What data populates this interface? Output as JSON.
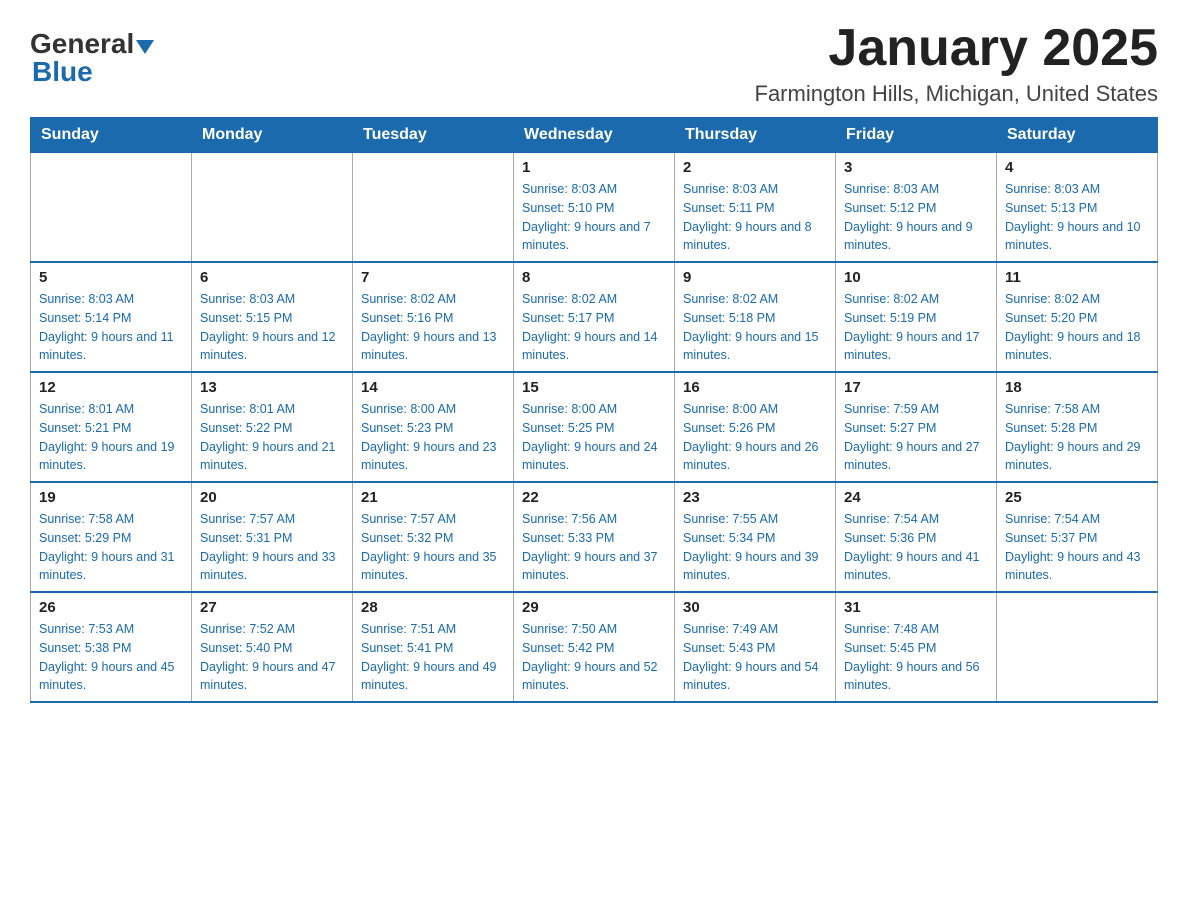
{
  "header": {
    "logo": {
      "general": "General",
      "blue": "Blue",
      "alt": "GeneralBlue logo"
    },
    "title": "January 2025",
    "subtitle": "Farmington Hills, Michigan, United States"
  },
  "calendar": {
    "days_of_week": [
      "Sunday",
      "Monday",
      "Tuesday",
      "Wednesday",
      "Thursday",
      "Friday",
      "Saturday"
    ],
    "weeks": [
      {
        "days": [
          {
            "number": "",
            "info": ""
          },
          {
            "number": "",
            "info": ""
          },
          {
            "number": "",
            "info": ""
          },
          {
            "number": "1",
            "info": "Sunrise: 8:03 AM\nSunset: 5:10 PM\nDaylight: 9 hours and 7 minutes."
          },
          {
            "number": "2",
            "info": "Sunrise: 8:03 AM\nSunset: 5:11 PM\nDaylight: 9 hours and 8 minutes."
          },
          {
            "number": "3",
            "info": "Sunrise: 8:03 AM\nSunset: 5:12 PM\nDaylight: 9 hours and 9 minutes."
          },
          {
            "number": "4",
            "info": "Sunrise: 8:03 AM\nSunset: 5:13 PM\nDaylight: 9 hours and 10 minutes."
          }
        ]
      },
      {
        "days": [
          {
            "number": "5",
            "info": "Sunrise: 8:03 AM\nSunset: 5:14 PM\nDaylight: 9 hours and 11 minutes."
          },
          {
            "number": "6",
            "info": "Sunrise: 8:03 AM\nSunset: 5:15 PM\nDaylight: 9 hours and 12 minutes."
          },
          {
            "number": "7",
            "info": "Sunrise: 8:02 AM\nSunset: 5:16 PM\nDaylight: 9 hours and 13 minutes."
          },
          {
            "number": "8",
            "info": "Sunrise: 8:02 AM\nSunset: 5:17 PM\nDaylight: 9 hours and 14 minutes."
          },
          {
            "number": "9",
            "info": "Sunrise: 8:02 AM\nSunset: 5:18 PM\nDaylight: 9 hours and 15 minutes."
          },
          {
            "number": "10",
            "info": "Sunrise: 8:02 AM\nSunset: 5:19 PM\nDaylight: 9 hours and 17 minutes."
          },
          {
            "number": "11",
            "info": "Sunrise: 8:02 AM\nSunset: 5:20 PM\nDaylight: 9 hours and 18 minutes."
          }
        ]
      },
      {
        "days": [
          {
            "number": "12",
            "info": "Sunrise: 8:01 AM\nSunset: 5:21 PM\nDaylight: 9 hours and 19 minutes."
          },
          {
            "number": "13",
            "info": "Sunrise: 8:01 AM\nSunset: 5:22 PM\nDaylight: 9 hours and 21 minutes."
          },
          {
            "number": "14",
            "info": "Sunrise: 8:00 AM\nSunset: 5:23 PM\nDaylight: 9 hours and 23 minutes."
          },
          {
            "number": "15",
            "info": "Sunrise: 8:00 AM\nSunset: 5:25 PM\nDaylight: 9 hours and 24 minutes."
          },
          {
            "number": "16",
            "info": "Sunrise: 8:00 AM\nSunset: 5:26 PM\nDaylight: 9 hours and 26 minutes."
          },
          {
            "number": "17",
            "info": "Sunrise: 7:59 AM\nSunset: 5:27 PM\nDaylight: 9 hours and 27 minutes."
          },
          {
            "number": "18",
            "info": "Sunrise: 7:58 AM\nSunset: 5:28 PM\nDaylight: 9 hours and 29 minutes."
          }
        ]
      },
      {
        "days": [
          {
            "number": "19",
            "info": "Sunrise: 7:58 AM\nSunset: 5:29 PM\nDaylight: 9 hours and 31 minutes."
          },
          {
            "number": "20",
            "info": "Sunrise: 7:57 AM\nSunset: 5:31 PM\nDaylight: 9 hours and 33 minutes."
          },
          {
            "number": "21",
            "info": "Sunrise: 7:57 AM\nSunset: 5:32 PM\nDaylight: 9 hours and 35 minutes."
          },
          {
            "number": "22",
            "info": "Sunrise: 7:56 AM\nSunset: 5:33 PM\nDaylight: 9 hours and 37 minutes."
          },
          {
            "number": "23",
            "info": "Sunrise: 7:55 AM\nSunset: 5:34 PM\nDaylight: 9 hours and 39 minutes."
          },
          {
            "number": "24",
            "info": "Sunrise: 7:54 AM\nSunset: 5:36 PM\nDaylight: 9 hours and 41 minutes."
          },
          {
            "number": "25",
            "info": "Sunrise: 7:54 AM\nSunset: 5:37 PM\nDaylight: 9 hours and 43 minutes."
          }
        ]
      },
      {
        "days": [
          {
            "number": "26",
            "info": "Sunrise: 7:53 AM\nSunset: 5:38 PM\nDaylight: 9 hours and 45 minutes."
          },
          {
            "number": "27",
            "info": "Sunrise: 7:52 AM\nSunset: 5:40 PM\nDaylight: 9 hours and 47 minutes."
          },
          {
            "number": "28",
            "info": "Sunrise: 7:51 AM\nSunset: 5:41 PM\nDaylight: 9 hours and 49 minutes."
          },
          {
            "number": "29",
            "info": "Sunrise: 7:50 AM\nSunset: 5:42 PM\nDaylight: 9 hours and 52 minutes."
          },
          {
            "number": "30",
            "info": "Sunrise: 7:49 AM\nSunset: 5:43 PM\nDaylight: 9 hours and 54 minutes."
          },
          {
            "number": "31",
            "info": "Sunrise: 7:48 AM\nSunset: 5:45 PM\nDaylight: 9 hours and 56 minutes."
          },
          {
            "number": "",
            "info": ""
          }
        ]
      }
    ]
  }
}
